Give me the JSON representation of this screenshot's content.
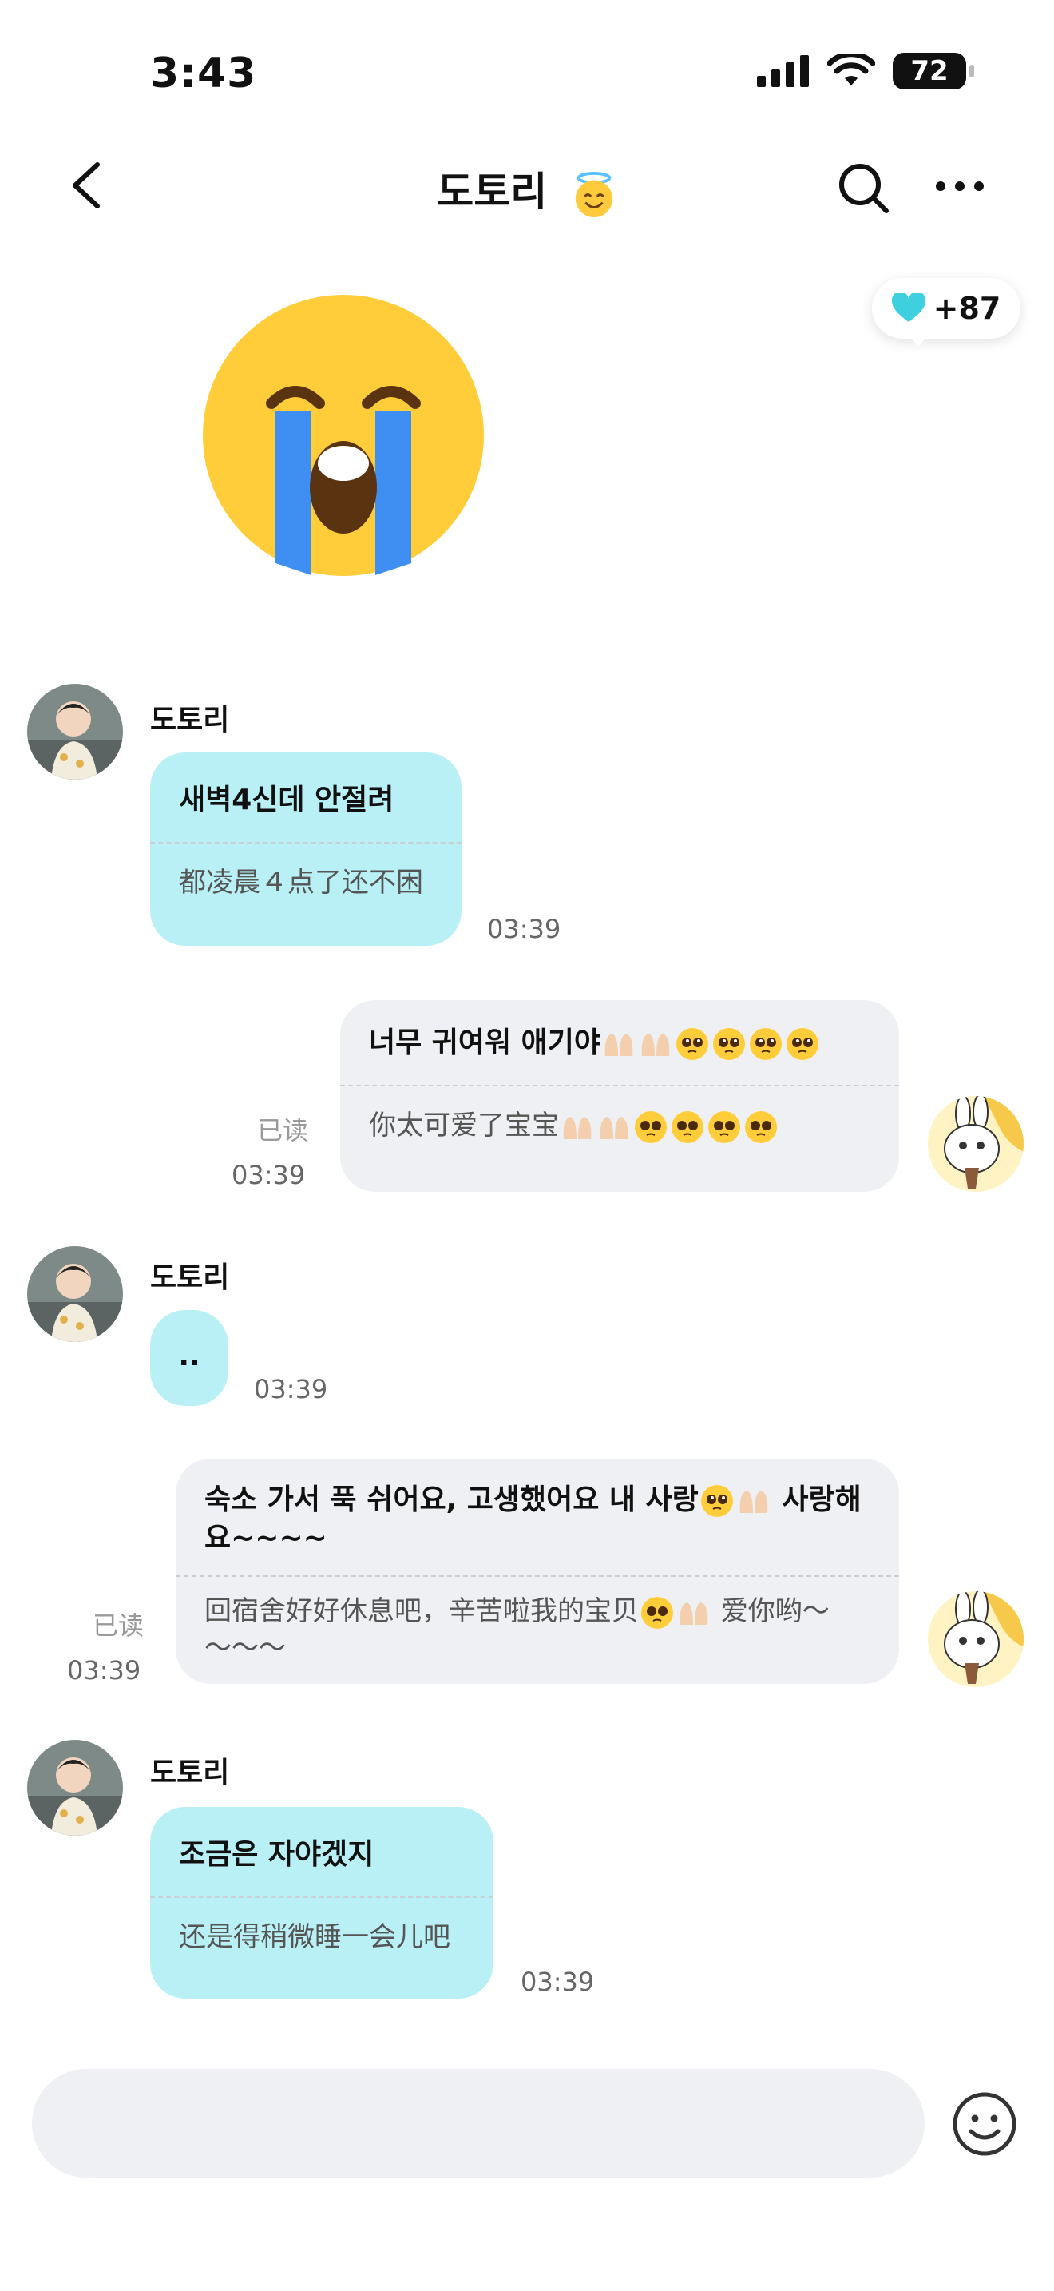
{
  "status_bar": {
    "time": "3:43",
    "battery": "72"
  },
  "header": {
    "title": "도토리",
    "title_emoji": "smiling-halo-face-icon"
  },
  "heart_badge": {
    "count": "+87",
    "color": "#3fd0e0"
  },
  "sticker": {
    "icon": "loudly-crying-face-icon"
  },
  "messages": [
    {
      "side": "in",
      "sender": "도토리",
      "text": "새벽4신데 안절려",
      "translation": "都凌晨４点了还不困",
      "time": "03:39"
    },
    {
      "side": "out",
      "text": "너무 귀여워 애기야",
      "emojis": [
        "palms-up-icon",
        "palms-up-icon",
        "pleading-face-icon",
        "pleading-face-icon",
        "pleading-face-icon",
        "pleading-face-icon"
      ],
      "translation": "你太可爱了宝宝",
      "read": "已读",
      "time": "03:39"
    },
    {
      "side": "in",
      "sender": "도토리",
      "text": "..",
      "time": "03:39"
    },
    {
      "side": "out",
      "text_a": "숙소 가서 푹 쉬어요, 고생했어요 내 사랑",
      "text_b": "사랑해",
      "text_c": "요~~~~",
      "translation_a": "回宿舍好好休息吧，辛苦啦我的宝贝",
      "translation_b": "爱你哟～",
      "translation_c": "～～～",
      "read": "已读",
      "time": "03:39"
    },
    {
      "side": "in",
      "sender": "도토리",
      "text": "조금은 자야겠지",
      "translation": "还是得稍微睡一会儿吧",
      "time": "03:39"
    }
  ],
  "colors": {
    "incoming_bubble": "#b9f0f5",
    "outgoing_bubble": "#eef0f3"
  }
}
